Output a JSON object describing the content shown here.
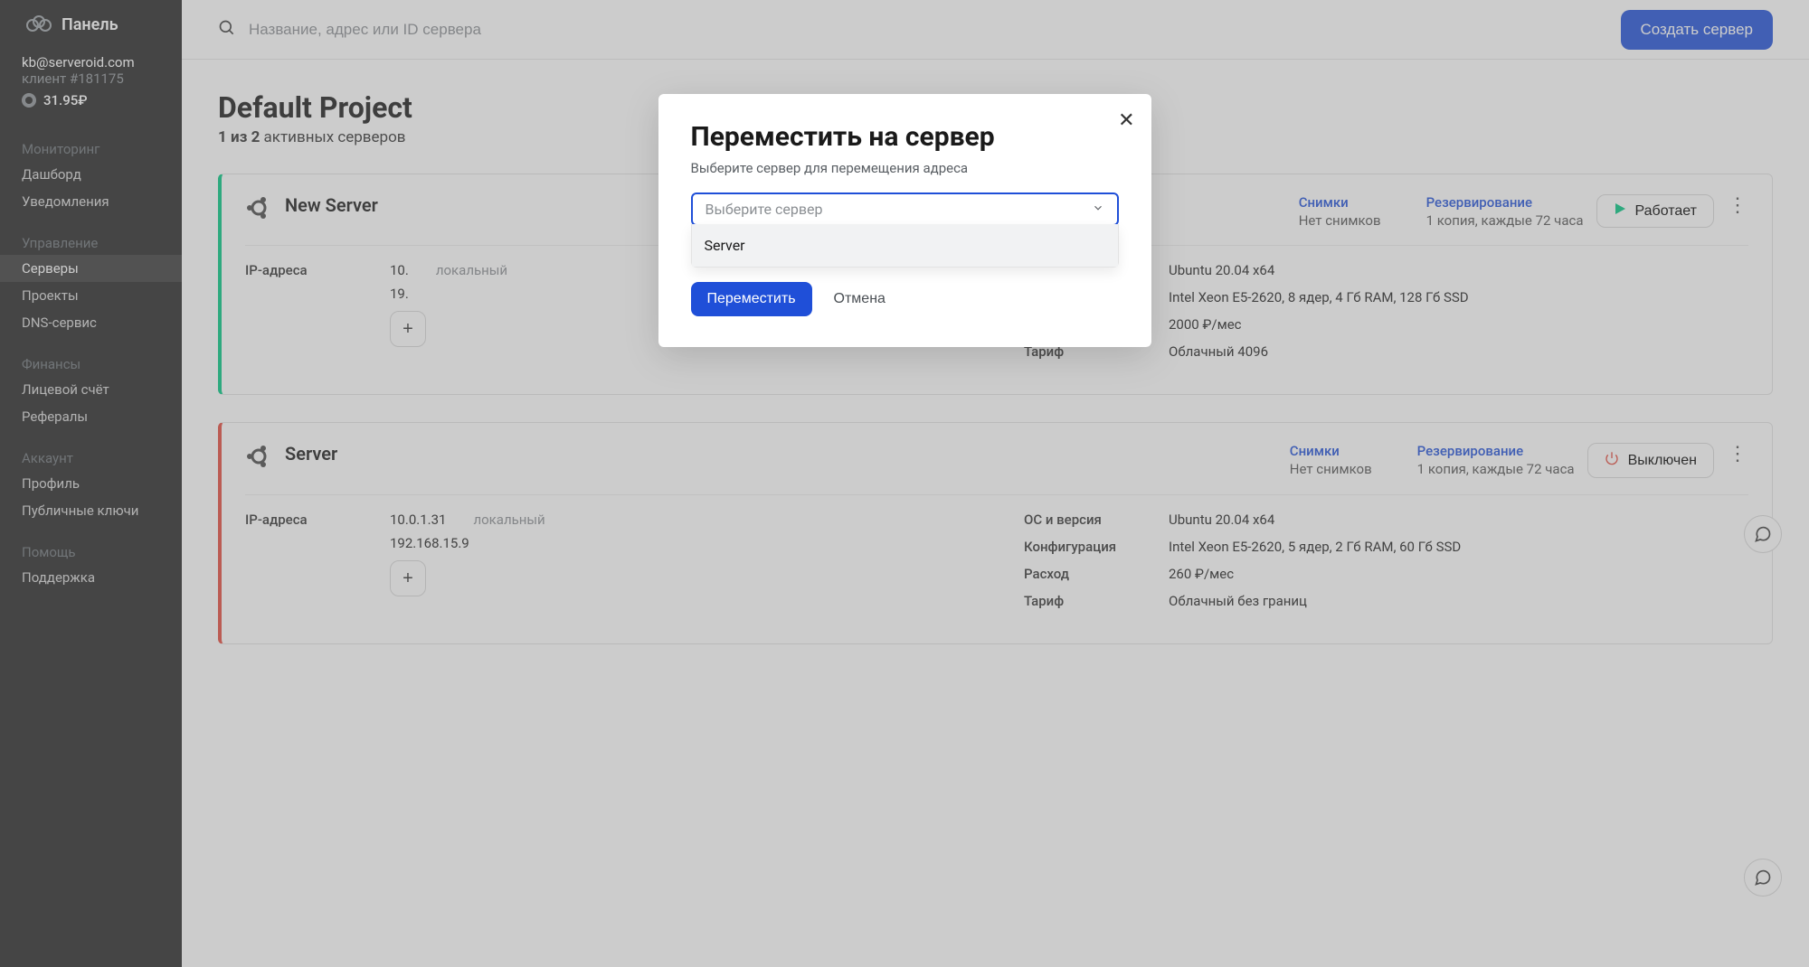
{
  "brand": {
    "title": "Панель"
  },
  "account": {
    "email": "kb@serveroid.com",
    "client_id": "клиент #181175",
    "balance": "31.95₽"
  },
  "sidebar": {
    "monitoring_heading": "Мониторинг",
    "dashboard": "Дашборд",
    "notifications": "Уведомления",
    "manage_heading": "Управление",
    "servers": "Серверы",
    "projects": "Проекты",
    "dns": "DNS-сервис",
    "finance_heading": "Финансы",
    "billing": "Лицевой счёт",
    "referrals": "Рефералы",
    "account_heading": "Аккаунт",
    "profile": "Профиль",
    "keys": "Публичные ключи",
    "help_heading": "Помощь",
    "support": "Поддержка"
  },
  "topbar": {
    "search_placeholder": "Название, адрес или ID сервера",
    "create": "Создать сервер"
  },
  "page": {
    "title": "Default Project",
    "sub_bold": "1 из 2",
    "sub_rest": " активных серверов"
  },
  "labels": {
    "ip_addresses": "IP-адреса",
    "local": "локальный",
    "snapshots": "Снимки",
    "backup": "Резервирование",
    "os": "ОС и версия",
    "config": "Конфигурация",
    "cost": "Расход",
    "tariff": "Тариф"
  },
  "servers": [
    {
      "name": "New Server",
      "status": "Работает",
      "status_kind": "running",
      "snapshot_sub": "Нет снимков",
      "backup_sub": "1 копия, каждые 72 часа",
      "ips": [
        {
          "addr": "10.",
          "local": true
        },
        {
          "addr": "19.",
          "local": false
        }
      ],
      "os": "Ubuntu 20.04 x64",
      "config": "Intel Xeon E5-2620, 8 ядер, 4 Гб RAM, 128 Гб SSD",
      "cost": "2000 ₽/мес",
      "tariff": "Облачный 4096"
    },
    {
      "name": "Server",
      "status": "Выключен",
      "status_kind": "off",
      "snapshot_sub": "Нет снимков",
      "backup_sub": "1 копия, каждые 72 часа",
      "ips": [
        {
          "addr": "10.0.1.31",
          "local": true
        },
        {
          "addr": "192.168.15.9",
          "local": false
        }
      ],
      "os": "Ubuntu 20.04 x64",
      "config": "Intel Xeon E5-2620, 5 ядер, 2 Гб RAM, 60 Гб SSD",
      "cost": "260 ₽/мес",
      "tariff": "Облачный без границ"
    }
  ],
  "modal": {
    "title": "Переместить на сервер",
    "desc": "Выберите сервер для перемещения адреса",
    "combo_placeholder": "Выберите сервер",
    "option": "Server",
    "submit": "Переместить",
    "cancel": "Отмена"
  }
}
